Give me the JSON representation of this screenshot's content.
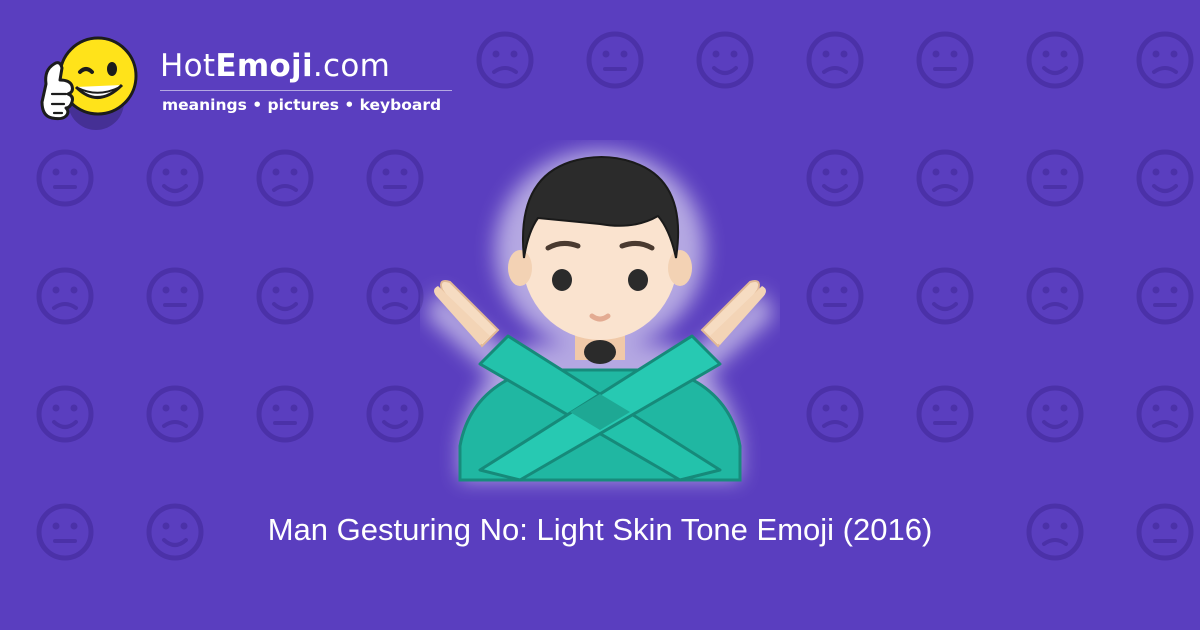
{
  "logo": {
    "icon": "thumbs-up-winking-smiley-icon",
    "title_regular_start": "Hot",
    "title_bold": "Emoji",
    "title_regular_end": ".com",
    "tagline": "meanings • pictures • keyboard"
  },
  "hero": {
    "icon": "man-gesturing-no-light-skin-tone-emoji"
  },
  "caption": "Man Gesturing No: Light Skin Tone Emoji (2016)",
  "background": {
    "color": "#5a3ebf",
    "pattern": "faint-emoji-tile-pattern"
  }
}
